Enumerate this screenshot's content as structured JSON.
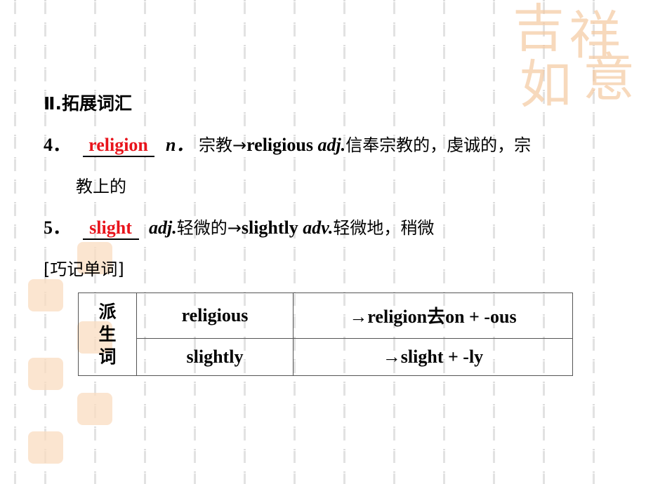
{
  "section": {
    "heading": "Ⅱ.拓展词汇"
  },
  "items": [
    {
      "number": "4．",
      "answer": "religion",
      "pos": "n．",
      "meaning": "宗教",
      "arrow": "→",
      "derived": "religious",
      "derived_pos": "adj.",
      "derived_meaning_line1": "信奉宗教的，虔诚的，宗",
      "derived_meaning_line2": "教上的"
    },
    {
      "number": "5．",
      "answer": "slight",
      "pos": "adj.",
      "meaning": "轻微的",
      "arrow": "→",
      "derived": "slightly",
      "derived_pos": "adv.",
      "derived_meaning_line1": "轻微地，稍微"
    }
  ],
  "memory_tip": {
    "label": "[巧记单词]"
  },
  "table": {
    "category_chars": [
      "派",
      "生",
      "词"
    ],
    "rows": [
      {
        "word": "religious",
        "formation": "→religion去on + -ous"
      },
      {
        "word": "slightly",
        "formation": "→slight + -ly"
      }
    ]
  },
  "decoration": {
    "seal_text": "吉祥如意",
    "accent_color": "#e8141c",
    "seal_color": "#f5c9a0"
  }
}
